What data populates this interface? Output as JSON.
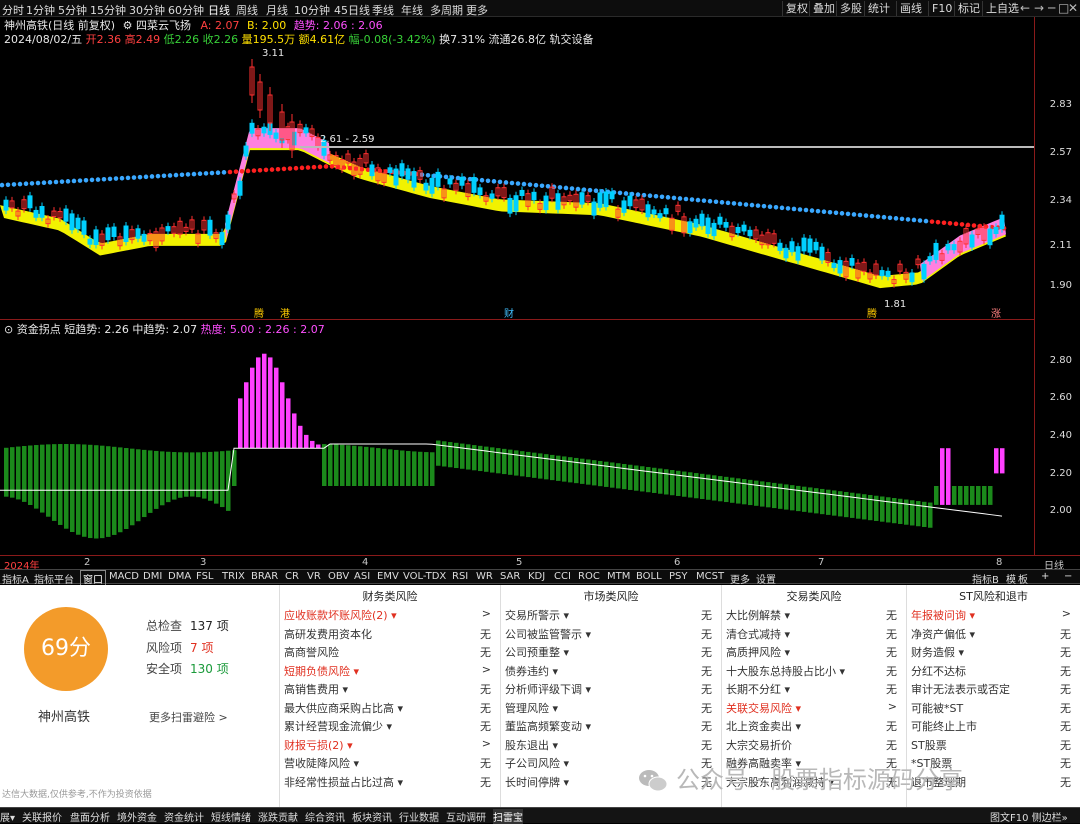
{
  "periods": [
    "分时",
    "1分钟",
    "5分钟",
    "15分钟",
    "30分钟",
    "60分钟",
    "日线",
    "周线",
    "月线",
    "10分钟",
    "45日线",
    "季线",
    "年线",
    "多周期",
    "更多"
  ],
  "tools": [
    "复权",
    "叠加",
    "多股",
    "统计",
    "画线",
    "F10",
    "标记",
    "上自选"
  ],
  "window_controls": [
    "←",
    "→",
    "─",
    "□",
    "✕"
  ],
  "main_chart": {
    "title": "神州高铁(日线 前复权)",
    "indicator_name": "四菜云飞扬",
    "a_label": "A: 2.07",
    "b_label": "B: 2.00",
    "trend_label": "趋势: 2.06 : 2.06",
    "date": "2024/08/02/五",
    "open": "开2.36",
    "high": "高2.49",
    "low": "低2.26",
    "close": "收2.26",
    "volume": "量195.5万",
    "amount": "额4.61亿",
    "change": "幅-0.08(-3.42%)",
    "turnover": "换7.31%",
    "float_cap": "流通26.8亿",
    "settings": "轨交设备",
    "y_ticks": [
      "2.83",
      "2.57",
      "2.34",
      "2.11",
      "1.90"
    ],
    "high_mark": "3.11",
    "low_mark": "1.81",
    "range_label": "2.61 - 2.59",
    "event_labels": [
      "腾",
      "港",
      "财",
      "腾",
      "涨"
    ]
  },
  "sub_chart": {
    "title": "资金拐点",
    "short_trend": "短趋势: 2.26",
    "mid_trend": "中趋势: 2.07",
    "heat": "热度: 5.00 : 2.26 : 2.07",
    "y_ticks": [
      "2.80",
      "2.60",
      "2.40",
      "2.20",
      "2.00"
    ]
  },
  "time_axis": [
    "2024年",
    "2",
    "3",
    "4",
    "5",
    "6",
    "7",
    "8"
  ],
  "time_axis_right": "日线",
  "indicator_tabs": [
    "指标A",
    "指标平台",
    "窗口",
    "MACD",
    "DMI",
    "DMA",
    "FSL",
    "TRIX",
    "BRAR",
    "CR",
    "VR",
    "OBV",
    "ASI",
    "EMV",
    "VOL-TDX",
    "RSI",
    "WR",
    "SAR",
    "KDJ",
    "CCI",
    "ROC",
    "MTM",
    "BOLL",
    "PSY",
    "MCST",
    "更多",
    "设置"
  ],
  "indicator_tabs_right": [
    "指标B",
    "模",
    "板",
    "+",
    "−"
  ],
  "risk_panel": {
    "score": "69分",
    "stock_name": "神州高铁",
    "total_label": "总检查",
    "total_value": "137 项",
    "risk_label": "风险项",
    "risk_value": "7 项",
    "safe_label": "安全项",
    "safe_value": "130 项",
    "more_link": "更多扫雷避险 >",
    "disclaimer": "达信大数据,仅供参考,不作为投资依据",
    "columns": [
      {
        "header": "财务类风险",
        "items": [
          {
            "label": "应收账款坏账风险(2) ▾",
            "status": ">",
            "hl": true
          },
          {
            "label": "高研发费用资本化",
            "status": "无"
          },
          {
            "label": "高商誉风险",
            "status": "无"
          },
          {
            "label": "短期负债风险 ▾",
            "status": ">",
            "hl": true
          },
          {
            "label": "高销售费用 ▾",
            "status": "无"
          },
          {
            "label": "最大供应商采购占比高 ▾",
            "status": "无"
          },
          {
            "label": "累计经营现金流偏少 ▾",
            "status": "无"
          },
          {
            "label": "财报亏损(2) ▾",
            "status": ">",
            "hl": true
          },
          {
            "label": "营收陡降风险 ▾",
            "status": "无"
          },
          {
            "label": "非经常性损益占比过高 ▾",
            "status": "无"
          }
        ]
      },
      {
        "header": "市场类风险",
        "items": [
          {
            "label": "交易所警示 ▾",
            "status": "无"
          },
          {
            "label": "公司被监管警示 ▾",
            "status": "无"
          },
          {
            "label": "公司预重整 ▾",
            "status": "无"
          },
          {
            "label": "债券违约 ▾",
            "status": "无"
          },
          {
            "label": "分析师评级下调 ▾",
            "status": "无"
          },
          {
            "label": "管理风险 ▾",
            "status": "无"
          },
          {
            "label": "董监高频繁变动 ▾",
            "status": "无"
          },
          {
            "label": "股东退出 ▾",
            "status": "无"
          },
          {
            "label": "子公司风险 ▾",
            "status": "无"
          },
          {
            "label": "长时间停牌 ▾",
            "status": "无"
          }
        ]
      },
      {
        "header": "交易类风险",
        "items": [
          {
            "label": "大比例解禁 ▾",
            "status": "无"
          },
          {
            "label": "清仓式减持 ▾",
            "status": "无"
          },
          {
            "label": "高质押风险 ▾",
            "status": "无"
          },
          {
            "label": "十大股东总持股占比小 ▾",
            "status": "无"
          },
          {
            "label": "长期不分红 ▾",
            "status": "无"
          },
          {
            "label": "关联交易风险 ▾",
            "status": ">",
            "hl": true
          },
          {
            "label": "北上资金卖出 ▾",
            "status": "无"
          },
          {
            "label": "大宗交易折价",
            "status": "无"
          },
          {
            "label": "融券高融卖率 ▾",
            "status": "无"
          },
          {
            "label": "大宗股东高利润减持 ▾",
            "status": "无"
          }
        ]
      },
      {
        "header": "ST风险和退市",
        "items": [
          {
            "label": "年报被问询 ▾",
            "status": ">",
            "hl": true
          },
          {
            "label": "净资产偏低 ▾",
            "status": "无"
          },
          {
            "label": "财务造假 ▾",
            "status": "无"
          },
          {
            "label": "分红不达标",
            "status": "无"
          },
          {
            "label": "审计无法表示或否定",
            "status": "无"
          },
          {
            "label": "可能被*ST",
            "status": "无"
          },
          {
            "label": "可能终止上市",
            "status": "无"
          },
          {
            "label": "ST股票",
            "status": "无"
          },
          {
            "label": "*ST股票",
            "status": "无"
          },
          {
            "label": "退市整理期",
            "status": "无"
          }
        ]
      }
    ]
  },
  "watermark": "公众号 · 股票指标源码分享",
  "bottom_tabs": [
    "展▾",
    "关联报价",
    "盘面分析",
    "境外资金",
    "资金统计",
    "短线情绪",
    "涨跌贡献",
    "综合资讯",
    "板块资讯",
    "行业数据",
    "互动调研",
    "扫雷宝"
  ],
  "bottom_right": "图文F10 侧边栏»",
  "colors": {
    "up": "#ff3030",
    "down": "#00d0ff",
    "ma_yellow": "#ffff00",
    "ma_pink": "#ff80e0",
    "ma_blue": "#3aa8ff",
    "ma_red": "#ff2020",
    "vol_green": "#1b8a1b",
    "vol_magenta": "#ff40ff",
    "risk_red": "#e03020",
    "score_orange": "#f39b2a"
  }
}
